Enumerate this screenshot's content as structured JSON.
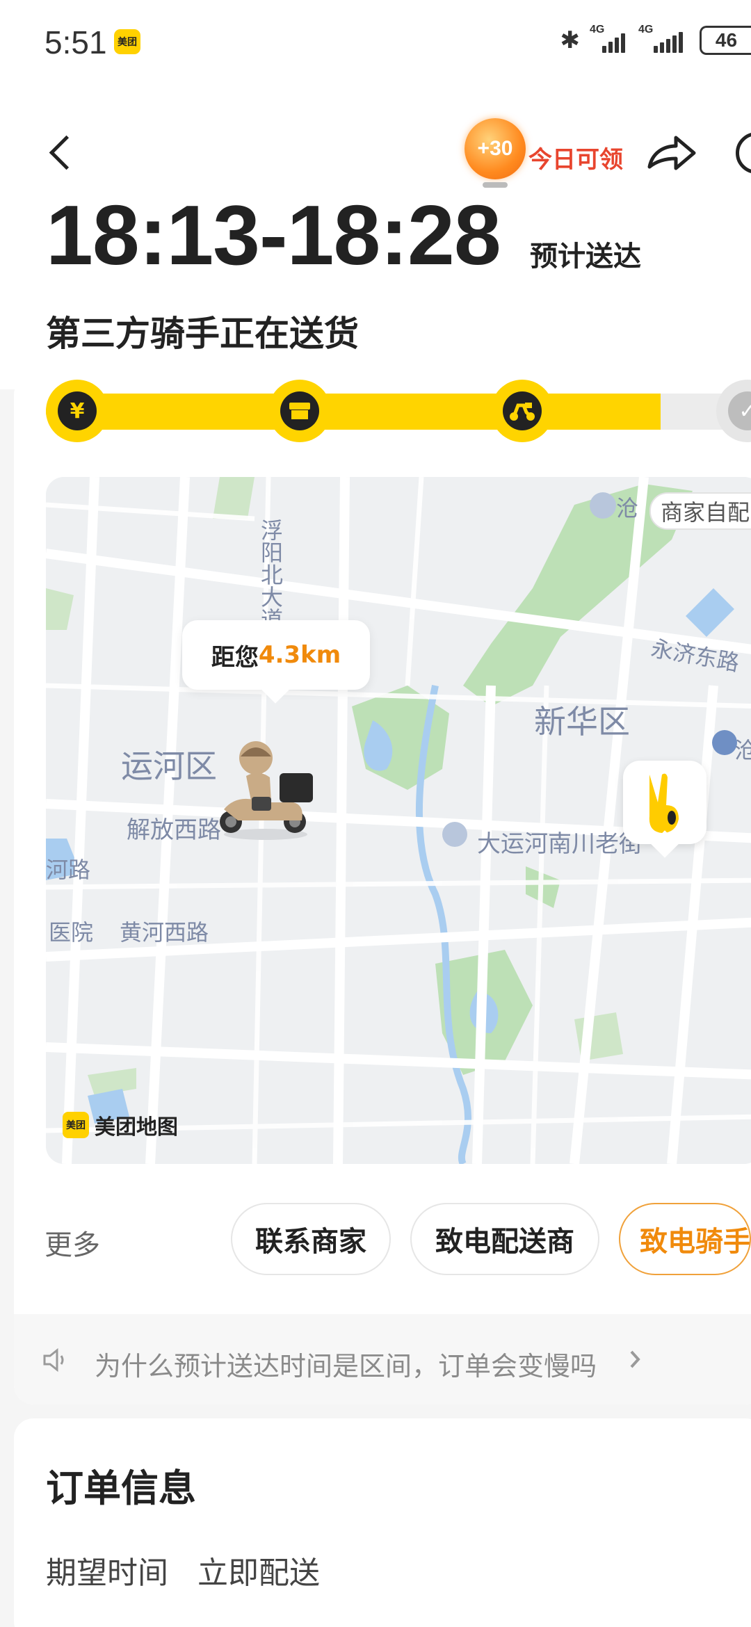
{
  "status_bar": {
    "time": "5:51",
    "app_badge": "美团",
    "bluetooth_icon": "bluetooth-icon",
    "network1": "4G",
    "network2": "4G",
    "battery": "46"
  },
  "header": {
    "back_icon": "back-chevron-icon",
    "coin_value": "+30",
    "coin_label": "今日可领",
    "share_icon": "share-icon"
  },
  "eta": {
    "time_range": "18:13-18:28",
    "label": "预计送达"
  },
  "delivery_status": "第三方骑手正在送货",
  "progress": {
    "fraction": 0.85,
    "steps": [
      {
        "icon": "yen-icon",
        "glyph": "¥"
      },
      {
        "icon": "store-icon",
        "glyph": ""
      },
      {
        "icon": "scooter-icon",
        "glyph": ""
      },
      {
        "icon": "check-icon",
        "glyph": "✓"
      }
    ]
  },
  "map": {
    "distance_prefix": "距您",
    "distance_value": "4.3km",
    "store_tag": "商家自配",
    "logo_badge": "美团",
    "logo_text": "美团地图",
    "labels": {
      "fuyang": "浮阳北大道",
      "cang": "沧",
      "yongji": "永济东路",
      "xinhua": "新华区",
      "cang2": "沧",
      "yunhe": "运河区",
      "jiefang": "解放西路",
      "dayunhe": "大运河南川老街",
      "hehelu": "河路",
      "huanghe": "黄河西路",
      "yiyuan": "医院"
    }
  },
  "actions": {
    "more_label": "更多",
    "contact_merchant": "联系商家",
    "call_courier_company": "致电配送商",
    "call_rider": "致电骑手"
  },
  "notice": {
    "text": "为什么预计送达时间是区间，订单会变慢吗"
  },
  "order_info": {
    "title": "订单信息",
    "expect_key": "期望时间",
    "expect_value": "立即配送"
  }
}
